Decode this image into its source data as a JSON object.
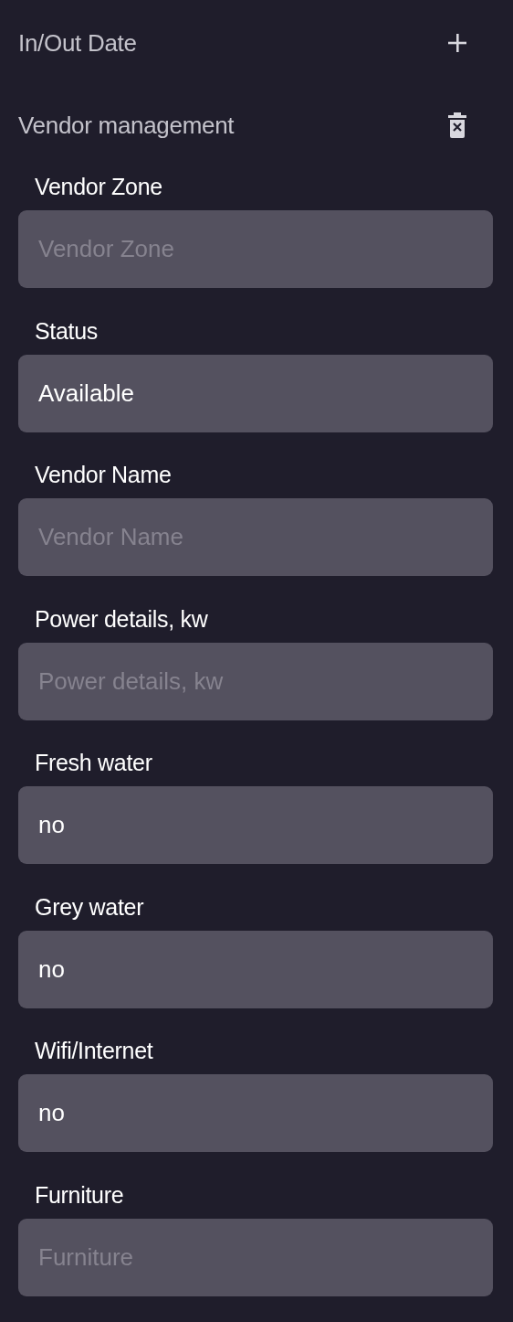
{
  "sections": [
    {
      "title": "In/Out Date",
      "expanded": false
    },
    {
      "title": "Vendor management",
      "expanded": true,
      "fields": [
        {
          "label": "Vendor Zone",
          "placeholder": "Vendor Zone"
        },
        {
          "label": "Status",
          "value": "Available"
        },
        {
          "label": "Vendor Name",
          "placeholder": "Vendor Name"
        },
        {
          "label": "Power details, kw",
          "placeholder": "Power details, kw"
        },
        {
          "label": "Fresh water",
          "value": "no"
        },
        {
          "label": "Grey water",
          "value": "no"
        },
        {
          "label": "Wifi/Internet",
          "value": "no"
        },
        {
          "label": "Furniture",
          "placeholder": "Furniture"
        }
      ]
    }
  ]
}
